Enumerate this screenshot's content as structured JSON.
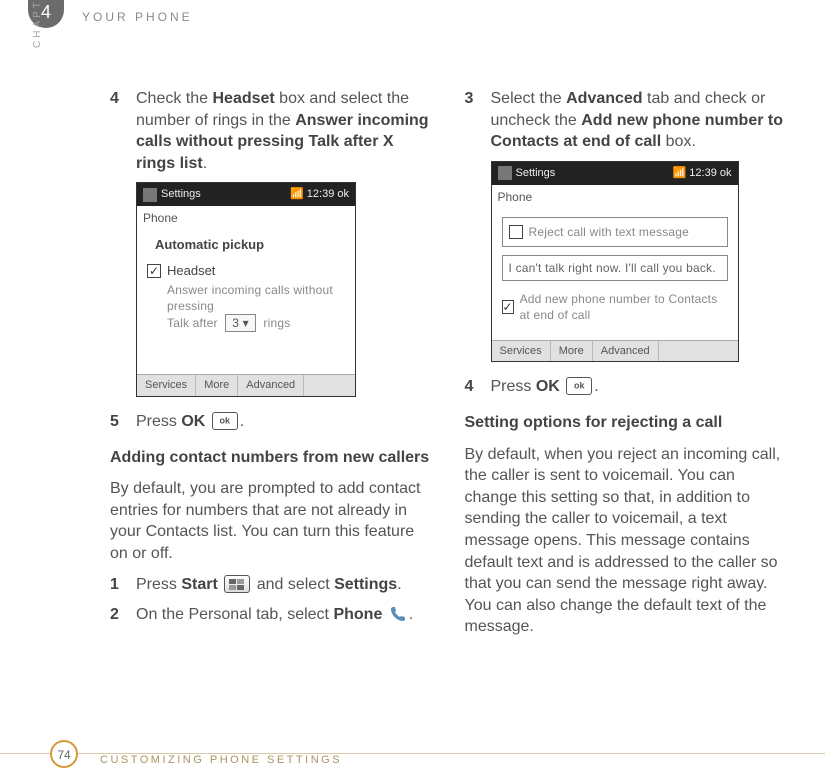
{
  "header": {
    "chapter_number": "4",
    "running_head": "YOUR PHONE",
    "side_label": "CHAPTER"
  },
  "left": {
    "step4": {
      "num": "4",
      "a": "Check the ",
      "b1": "Headset",
      "c": " box and select the number of rings in the ",
      "b2": "Answer incoming calls without pressing Talk after X rings list",
      "d": "."
    },
    "shot1": {
      "title": "Settings",
      "time": "12:39",
      "screen": "Phone",
      "group": "Automatic pickup",
      "headset_label": "Headset",
      "line1": "Answer incoming calls without pressing",
      "talk_after": "Talk after",
      "ring_value": "3",
      "rings_label": "rings",
      "tabs": [
        "Services",
        "More",
        "Advanced"
      ]
    },
    "step5": {
      "num": "5",
      "a": "Press ",
      "b": "OK",
      "c": "."
    },
    "h3": "Adding contact numbers from new callers",
    "p1": "By default, you are prompted to add contact entries for numbers that are not already in your Contacts list. You can turn this feature on or off.",
    "step1": {
      "num": "1",
      "a": "Press ",
      "b": "Start",
      "c": " and select ",
      "d": "Settings",
      "e": "."
    },
    "step2": {
      "num": "2",
      "a": "On the Personal tab, select ",
      "b": "Phone",
      "c": "."
    }
  },
  "right": {
    "step3": {
      "num": "3",
      "a": "Select the ",
      "b1": "Advanced",
      "c": " tab and check or uncheck the ",
      "b2": "Add new phone number to Contacts at end of call",
      "d": " box."
    },
    "shot2": {
      "title": "Settings",
      "time": "12:39",
      "screen": "Phone",
      "reject_label": "Reject call with text message",
      "reply_text": "I can't talk right now. I'll call you back.",
      "add_label": "Add new phone number to Contacts at end of call",
      "tabs": [
        "Services",
        "More",
        "Advanced"
      ]
    },
    "step4b": {
      "num": "4",
      "a": "Press ",
      "b": "OK",
      "c": "."
    },
    "h3": "Setting options for rejecting a call",
    "p1": "By default, when you reject an incoming call, the caller is sent to voicemail. You can change this setting so that, in addition to sending the caller to voicemail, a text message opens. This message contains default text and is addressed to the caller so that you can send the message right away. You can also change the default text of the message."
  },
  "footer": {
    "page": "74",
    "section": "CUSTOMIZING PHONE SETTINGS"
  }
}
